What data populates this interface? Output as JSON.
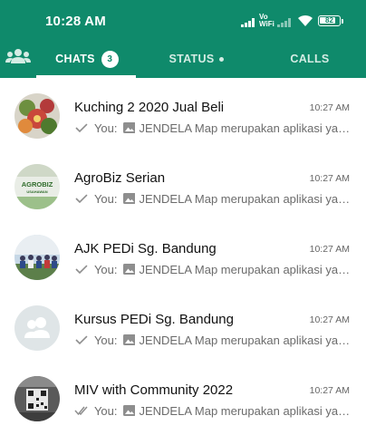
{
  "status_bar": {
    "time": "10:28 AM",
    "volte": "Vo",
    "wifi_label": "WiFi",
    "battery": "82"
  },
  "tabs": {
    "community_icon": "community-icon",
    "chats": {
      "label": "CHATS",
      "badge": "3"
    },
    "status": {
      "label": "STATUS"
    },
    "calls": {
      "label": "CALLS"
    }
  },
  "chats": [
    {
      "name": "Kuching 2 2020 Jual Beli",
      "time": "10:27 AM",
      "sender": "You:",
      "preview": "JENDELA Map merupakan aplikasi yang",
      "ticks": "single",
      "avatar": "flowers-photo"
    },
    {
      "name": "AgroBiz Serian",
      "time": "10:27 AM",
      "sender": "You:",
      "preview": "JENDELA Map merupakan aplikasi yang",
      "ticks": "single",
      "avatar": "agrobiz-logo",
      "avatar_text": "AGROBIZ",
      "avatar_subtext": "USAHAWAN"
    },
    {
      "name": "AJK PEDi Sg. Bandung",
      "time": "10:27 AM",
      "sender": "You:",
      "preview": "JENDELA Map merupakan aplikasi yang",
      "ticks": "single",
      "avatar": "group-photo"
    },
    {
      "name": "Kursus PEDi Sg. Bandung",
      "time": "10:27 AM",
      "sender": "You:",
      "preview": "JENDELA Map merupakan aplikasi yang",
      "ticks": "single",
      "avatar": "default-group-icon"
    },
    {
      "name": "MIV with Community 2022",
      "time": "10:27 AM",
      "sender": "You:",
      "preview": "JENDELA Map merupakan aplikasi yang",
      "ticks": "double",
      "avatar": "qr-photo"
    }
  ],
  "colors": {
    "header": "#0f8a6b",
    "tick": "#8e8e8e"
  }
}
